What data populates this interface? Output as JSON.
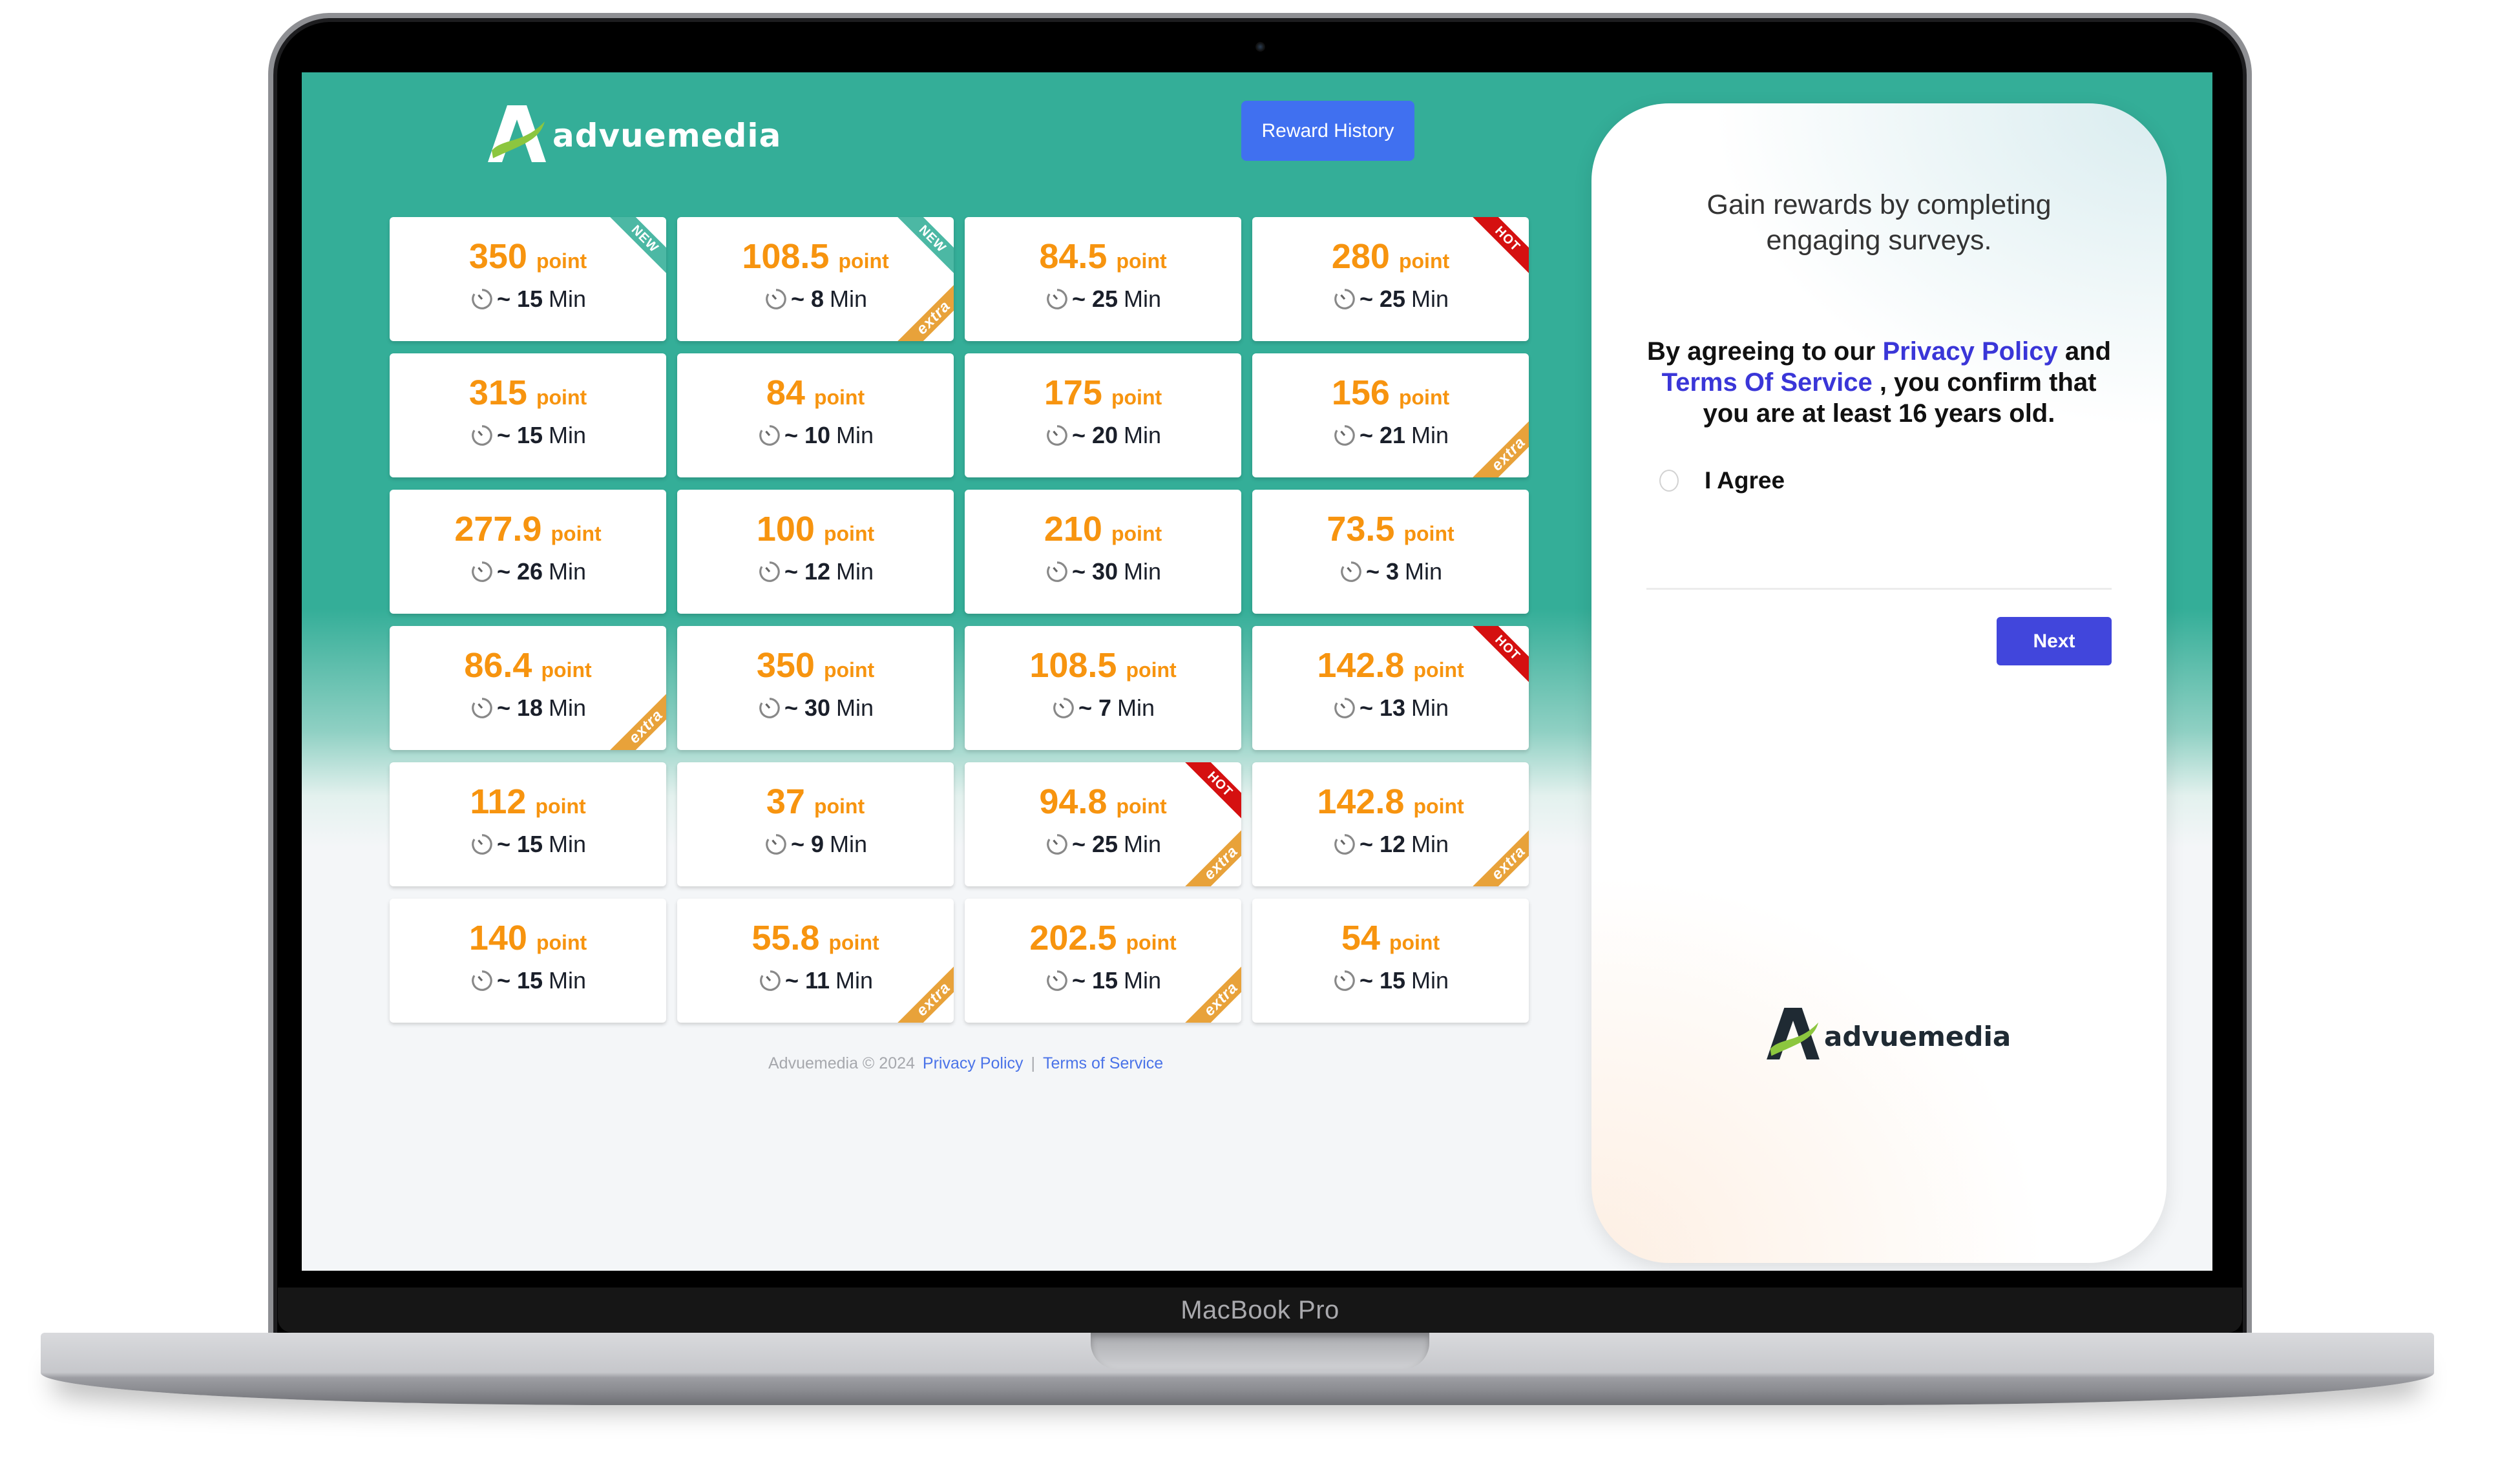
{
  "device": {
    "label": "MacBook Pro"
  },
  "header": {
    "brand_name": "advuemedia",
    "reward_history_label": "Reward History"
  },
  "colors": {
    "header_teal": "#34ae98",
    "points_orange": "#f7940f",
    "reward_button_blue": "#4070f0",
    "next_button_blue": "#4146dc",
    "link_blue": "#3a36d8",
    "badge_new": "#4cb8a4",
    "badge_hot": "#d51010",
    "badge_extra": "#e8a23a"
  },
  "surveys": {
    "point_unit": "point",
    "time_prefix": "~",
    "time_unit": "Min",
    "items": [
      {
        "points": "350",
        "minutes": "15",
        "top_badge": "NEW",
        "extra": false
      },
      {
        "points": "108.5",
        "minutes": "8",
        "top_badge": "NEW",
        "extra": true
      },
      {
        "points": "84.5",
        "minutes": "25",
        "top_badge": null,
        "extra": false
      },
      {
        "points": "280",
        "minutes": "25",
        "top_badge": "HOT",
        "extra": false
      },
      {
        "points": "315",
        "minutes": "15",
        "top_badge": null,
        "extra": false
      },
      {
        "points": "84",
        "minutes": "10",
        "top_badge": null,
        "extra": false
      },
      {
        "points": "175",
        "minutes": "20",
        "top_badge": null,
        "extra": false
      },
      {
        "points": "156",
        "minutes": "21",
        "top_badge": null,
        "extra": true
      },
      {
        "points": "277.9",
        "minutes": "26",
        "top_badge": null,
        "extra": false
      },
      {
        "points": "100",
        "minutes": "12",
        "top_badge": null,
        "extra": false
      },
      {
        "points": "210",
        "minutes": "30",
        "top_badge": null,
        "extra": false
      },
      {
        "points": "73.5",
        "minutes": "3",
        "top_badge": null,
        "extra": false
      },
      {
        "points": "86.4",
        "minutes": "18",
        "top_badge": null,
        "extra": true
      },
      {
        "points": "350",
        "minutes": "30",
        "top_badge": null,
        "extra": false
      },
      {
        "points": "108.5",
        "minutes": "7",
        "top_badge": null,
        "extra": false
      },
      {
        "points": "142.8",
        "minutes": "13",
        "top_badge": "HOT",
        "extra": false
      },
      {
        "points": "112",
        "minutes": "15",
        "top_badge": null,
        "extra": false
      },
      {
        "points": "37",
        "minutes": "9",
        "top_badge": null,
        "extra": false
      },
      {
        "points": "94.8",
        "minutes": "25",
        "top_badge": "HOT",
        "extra": true
      },
      {
        "points": "142.8",
        "minutes": "12",
        "top_badge": null,
        "extra": true
      },
      {
        "points": "140",
        "minutes": "15",
        "top_badge": null,
        "extra": false
      },
      {
        "points": "55.8",
        "minutes": "11",
        "top_badge": null,
        "extra": true
      },
      {
        "points": "202.5",
        "minutes": "15",
        "top_badge": null,
        "extra": true
      },
      {
        "points": "54",
        "minutes": "15",
        "top_badge": null,
        "extra": false
      }
    ],
    "extra_badge_label": "extra"
  },
  "footer": {
    "copyright": "Advuemedia © 2024",
    "privacy_label": "Privacy Policy",
    "separator": "|",
    "terms_label": "Terms of Service"
  },
  "panel": {
    "tagline": "Gain rewards by completing engaging surveys.",
    "consent_prefix": "By agreeing to our ",
    "consent_privacy": "Privacy Policy",
    "consent_and": " and ",
    "consent_terms": "Terms Of Service",
    "consent_suffix": " , you confirm that you are at least 16 years old.",
    "agree_label": "I Agree",
    "agree_checked": false,
    "next_label": "Next",
    "brand_name": "advuemedia"
  }
}
